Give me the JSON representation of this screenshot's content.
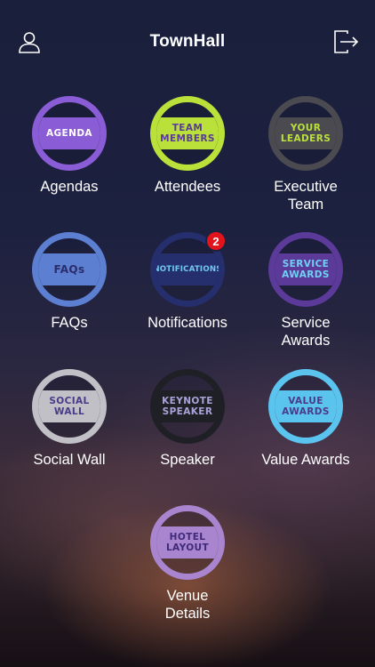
{
  "header": {
    "title": "TownHall",
    "left_icon": "user-profile-icon",
    "right_icon": "logout-icon"
  },
  "tiles": [
    {
      "badge_line1": "AGENDA",
      "badge_line2": "",
      "label": "Agendas",
      "ring": "#8a5cd6",
      "band": "#8a5cd6",
      "text_color": "#ffffff"
    },
    {
      "badge_line1": "TEAM",
      "badge_line2": "MEMBERS",
      "label": "Attendees",
      "ring": "#b9e13a",
      "band": "#b9e13a",
      "text_color": "#5b3a9a"
    },
    {
      "badge_line1": "YOUR",
      "badge_line2": "LEADERS",
      "label": "Executive Team",
      "ring": "#4a4a50",
      "band": "#4a4a50",
      "text_color": "#b9e13a"
    },
    {
      "badge_line1": "FAQs",
      "badge_line2": "",
      "label": "FAQs",
      "ring": "#5d7fd2",
      "band": "#5d7fd2",
      "text_color": "#2b2d6a"
    },
    {
      "badge_line1": "NOTIFICATIONS",
      "badge_line2": "",
      "label": "Notifications",
      "ring": "#262f6e",
      "band": "#262f6e",
      "text_color": "#6fc9f0",
      "count": "2"
    },
    {
      "badge_line1": "SERVICE",
      "badge_line2": "AWARDS",
      "label": "Service Awards",
      "ring": "#5b3a9a",
      "band": "#5b3a9a",
      "text_color": "#6fd1f3"
    },
    {
      "badge_line1": "SOCIAL",
      "badge_line2": "WALL",
      "label": "Social Wall",
      "ring": "#c0c0c6",
      "band": "#c0c0c6",
      "text_color": "#4a3a8a"
    },
    {
      "badge_line1": "KEYNOTE",
      "badge_line2": "SPEAKER",
      "label": "Speaker",
      "ring": "#1f1f26",
      "band": "#1f1f26",
      "text_color": "#a9a2d8"
    },
    {
      "badge_line1": "VALUE",
      "badge_line2": "AWARDS",
      "label": "Value Awards",
      "ring": "#5bc4ee",
      "band": "#5bc4ee",
      "text_color": "#4a3a8a"
    },
    {
      "badge_line1": "HOTEL",
      "badge_line2": "LAYOUT",
      "label": "Venue Details",
      "ring": "#a985cf",
      "band": "#a985cf",
      "text_color": "#3f2a7a"
    }
  ]
}
